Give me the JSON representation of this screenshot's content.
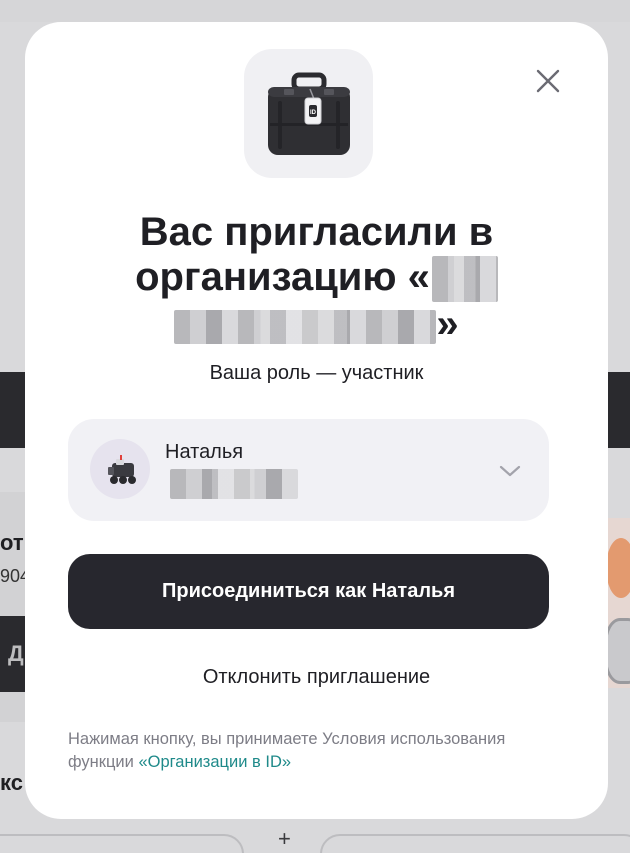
{
  "background": {
    "fragment_1": "от",
    "fragment_2": "904",
    "fragment_3": "Д",
    "fragment_4": "кс",
    "plus": "+"
  },
  "modal": {
    "title_line1": "Вас пригласили в",
    "title_line2_prefix": "организацию «",
    "title_line3_suffix": "»",
    "role": "Ваша роль — участник",
    "account": {
      "name": "Наталья"
    },
    "join_label": "Присоединиться как Наталья",
    "decline_label": "Отклонить приглашение",
    "legal_text": "Нажимая кнопку, вы принимаете Условия использования функции ",
    "legal_link": "«Организации в ID»",
    "icons": {
      "close": "close-icon",
      "logo": "briefcase-icon",
      "avatar": "robot-avatar-icon",
      "chevron": "chevron-down-icon"
    }
  }
}
